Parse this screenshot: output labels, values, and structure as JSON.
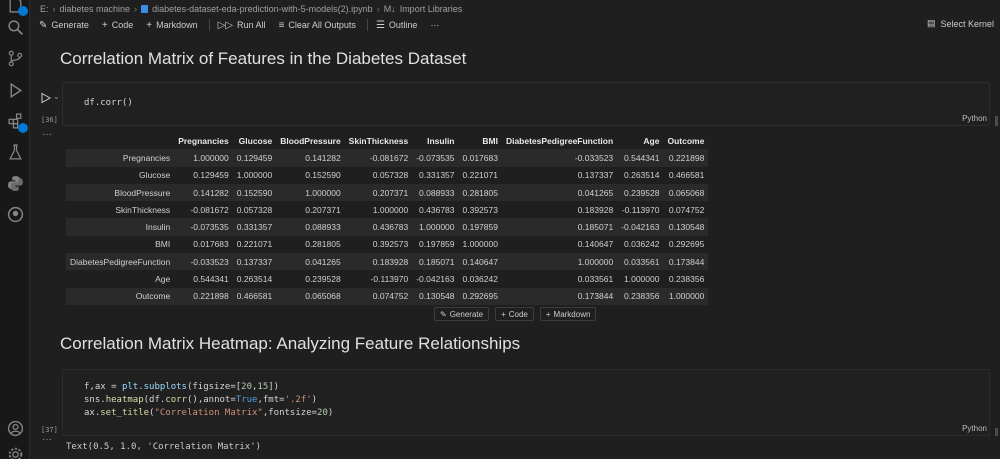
{
  "breadcrumb": {
    "root": "E:",
    "folder": "diabetes machine",
    "file": "diabetes-dataset-eda-prediction-with-5-models(2).ipynb",
    "md_prefix": "M↓",
    "section": "Import Libraries"
  },
  "toolbar": {
    "generate": "Generate",
    "code": "Code",
    "markdown": "Markdown",
    "run_all": "Run All",
    "clear_outputs": "Clear All Outputs",
    "outline": "Outline",
    "more": "···",
    "select_kernel": "Select Kernel"
  },
  "headings": {
    "h1": "Correlation Matrix of Features in the Diabetes Dataset",
    "h2": "Correlation Matrix Heatmap: Analyzing Feature Relationships"
  },
  "cell1": {
    "exec_count": "[36]",
    "code": "df.corr()",
    "language": "Python"
  },
  "corr_table": {
    "columns": [
      "",
      "Pregnancies",
      "Glucose",
      "BloodPressure",
      "SkinThickness",
      "Insulin",
      "BMI",
      "DiabetesPedigreeFunction",
      "Age",
      "Outcome"
    ],
    "rows": [
      [
        "Pregnancies",
        "1.000000",
        "0.129459",
        "0.141282",
        "-0.081672",
        "-0.073535",
        "0.017683",
        "-0.033523",
        "0.544341",
        "0.221898"
      ],
      [
        "Glucose",
        "0.129459",
        "1.000000",
        "0.152590",
        "0.057328",
        "0.331357",
        "0.221071",
        "0.137337",
        "0.263514",
        "0.466581"
      ],
      [
        "BloodPressure",
        "0.141282",
        "0.152590",
        "1.000000",
        "0.207371",
        "0.088933",
        "0.281805",
        "0.041265",
        "0.239528",
        "0.065068"
      ],
      [
        "SkinThickness",
        "-0.081672",
        "0.057328",
        "0.207371",
        "1.000000",
        "0.436783",
        "0.392573",
        "0.183928",
        "-0.113970",
        "0.074752"
      ],
      [
        "Insulin",
        "-0.073535",
        "0.331357",
        "0.088933",
        "0.436783",
        "1.000000",
        "0.197859",
        "0.185071",
        "-0.042163",
        "0.130548"
      ],
      [
        "BMI",
        "0.017683",
        "0.221071",
        "0.281805",
        "0.392573",
        "0.197859",
        "1.000000",
        "0.140647",
        "0.036242",
        "0.292695"
      ],
      [
        "DiabetesPedigreeFunction",
        "-0.033523",
        "0.137337",
        "0.041265",
        "0.183928",
        "0.185071",
        "0.140647",
        "1.000000",
        "0.033561",
        "0.173844"
      ],
      [
        "Age",
        "0.544341",
        "0.263514",
        "0.239528",
        "-0.113970",
        "-0.042163",
        "0.036242",
        "0.033561",
        "1.000000",
        "0.238356"
      ],
      [
        "Outcome",
        "0.221898",
        "0.466581",
        "0.065068",
        "0.074752",
        "0.130548",
        "0.292695",
        "0.173844",
        "0.238356",
        "1.000000"
      ]
    ]
  },
  "cell_add": {
    "generate": "Generate",
    "code": "Code",
    "markdown": "Markdown"
  },
  "cell2": {
    "exec_count": "[37]",
    "line1_a": "f,ax = ",
    "line1_fn": "plt.subplots",
    "line1_b": "(figsize=[",
    "line1_n1": "20",
    "line1_c": ",",
    "line1_n2": "15",
    "line1_d": "])",
    "line2_a": "sns.",
    "line2_fn": "heatmap",
    "line2_b": "(df.",
    "line2_fn2": "corr",
    "line2_c": "(),annot=",
    "line2_k": "True",
    "line2_d": ",fmt=",
    "line2_s": "'.2f'",
    "line2_e": ")",
    "line3_a": "ax.",
    "line3_fn": "set_title",
    "line3_b": "(",
    "line3_s": "\"Correlation Matrix\"",
    "line3_c": ",fontsize=",
    "line3_n": "20",
    "line3_d": ")",
    "language": "Python",
    "output": "Text(0.5, 1.0, 'Correlation Matrix')"
  },
  "out_dots": "···"
}
